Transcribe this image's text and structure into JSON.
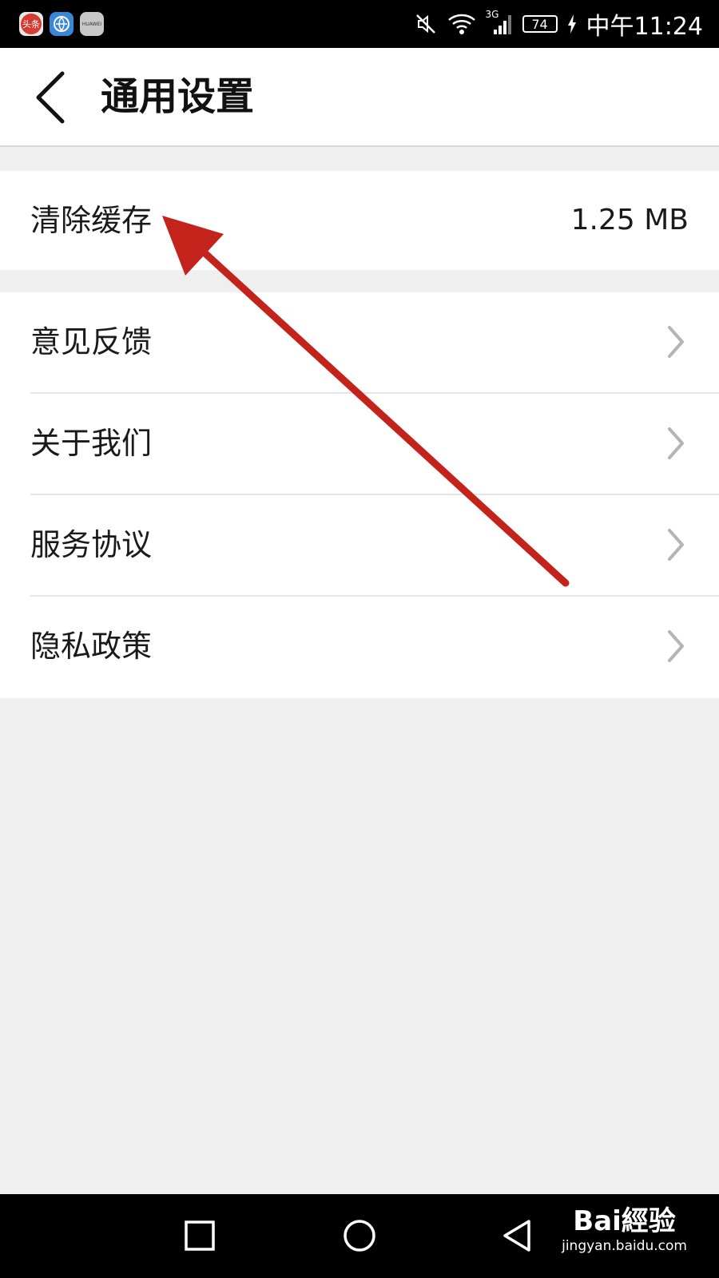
{
  "status_bar": {
    "app_icons": [
      {
        "name": "toutiao-app-icon",
        "label": "头条"
      },
      {
        "name": "browser-app-icon"
      },
      {
        "name": "huawei-app-icon",
        "label": "HUAWEI"
      }
    ],
    "network": "3G",
    "battery": "74",
    "time": "中午11:24"
  },
  "header": {
    "title": "通用设置"
  },
  "settings": {
    "clear_cache": {
      "label": "清除缓存",
      "value": "1.25 MB"
    },
    "items": [
      {
        "label": "意见反馈"
      },
      {
        "label": "关于我们"
      },
      {
        "label": "服务协议"
      },
      {
        "label": "隐私政策"
      }
    ]
  },
  "watermark": {
    "logo": "Bai經验",
    "url": "jingyan.baidu.com"
  },
  "colors": {
    "background": "#efefef",
    "surface": "#ffffff",
    "annotation_arrow": "#c4231b",
    "chevron": "#b5b5b5"
  }
}
